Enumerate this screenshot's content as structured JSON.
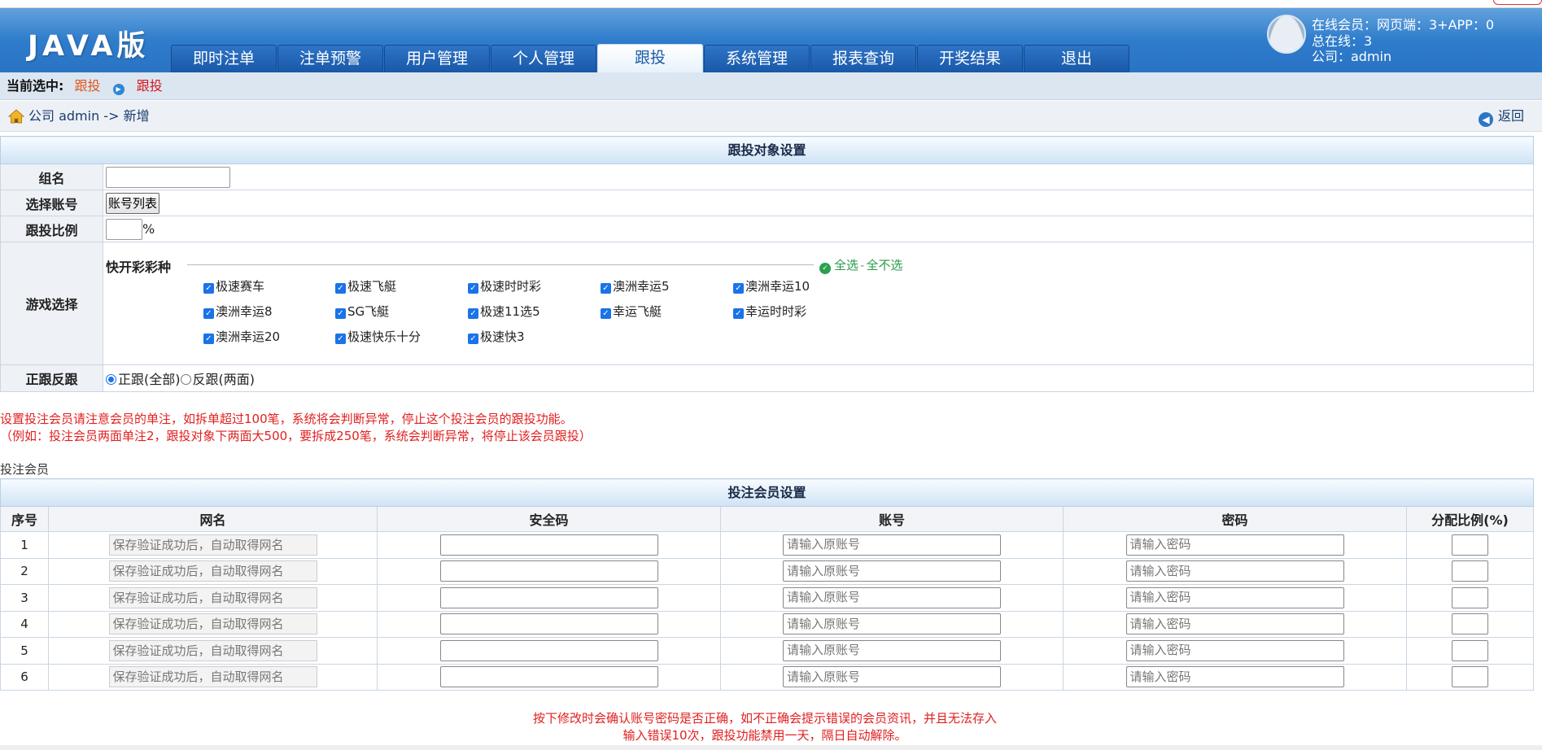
{
  "header": {
    "logo": "JAVA版",
    "tabs": [
      {
        "label": "即时注单",
        "active": false
      },
      {
        "label": "注单预警",
        "active": false
      },
      {
        "label": "用户管理",
        "active": false
      },
      {
        "label": "个人管理",
        "active": false
      },
      {
        "label": "跟投",
        "active": true
      },
      {
        "label": "系统管理",
        "active": false
      },
      {
        "label": "报表查询",
        "active": false
      },
      {
        "label": "开奖结果",
        "active": false
      },
      {
        "label": "退出",
        "active": false
      }
    ],
    "user": {
      "online": "在线会员：网页端：3+APP：0",
      "total": "总在线：3",
      "company": "公司：admin"
    }
  },
  "crumb": {
    "prefix": "当前选中:",
    "first": "跟投",
    "second": "跟投"
  },
  "path": {
    "text": "公司 admin -> 新增",
    "back": "返回"
  },
  "target_settings": {
    "title": "跟投对象设置",
    "group_label": "组名",
    "account_label": "选择账号",
    "account_button": "账号列表",
    "ratio_label": "跟投比例",
    "ratio_unit": "%",
    "game_label": "游戏选择",
    "game_category": "快开彩彩种",
    "select_all": "全选",
    "select_none": "全不选",
    "games": [
      "极速赛车",
      "极速飞艇",
      "极速时时彩",
      "澳洲幸运5",
      "澳洲幸运10",
      "澳洲幸运8",
      "SG飞艇",
      "极速11选5",
      "幸运飞艇",
      "幸运时时彩",
      "澳洲幸运20",
      "极速快乐十分",
      "极速快3"
    ],
    "direction_label": "正跟反跟",
    "direction_options": [
      "正跟(全部)",
      "反跟(两面)"
    ],
    "direction_selected": 0
  },
  "warning_top": [
    "设置投注会员请注意会员的单注，如拆单超过100笔，系统将会判断异常，停止这个投注会员的跟投功能。",
    "（例如：投注会员两面单注2，跟投对象下两面大500，要拆成250笔，系统会判断异常，将停止该会员跟投）"
  ],
  "members_section_label": "投注会员",
  "member_settings": {
    "title": "投注会员设置",
    "columns": [
      "序号",
      "网名",
      "安全码",
      "账号",
      "密码",
      "分配比例(%)"
    ],
    "nickname_placeholder": "保存验证成功后，自动取得网名",
    "account_placeholder": "请输入原账号",
    "password_placeholder": "请输入密码",
    "rows": [
      "1",
      "2",
      "3",
      "4",
      "5",
      "6"
    ]
  },
  "warning_bottom": [
    "按下修改时会确认账号密码是否正确，如不正确会提示错误的会员资讯，并且无法存入",
    "输入错误10次，跟投功能禁用一天，隔日自动解除。"
  ],
  "colors": {
    "header_blue": "#2f7dcc",
    "warning_red": "#e12020",
    "select_green": "#2a9a4a"
  }
}
